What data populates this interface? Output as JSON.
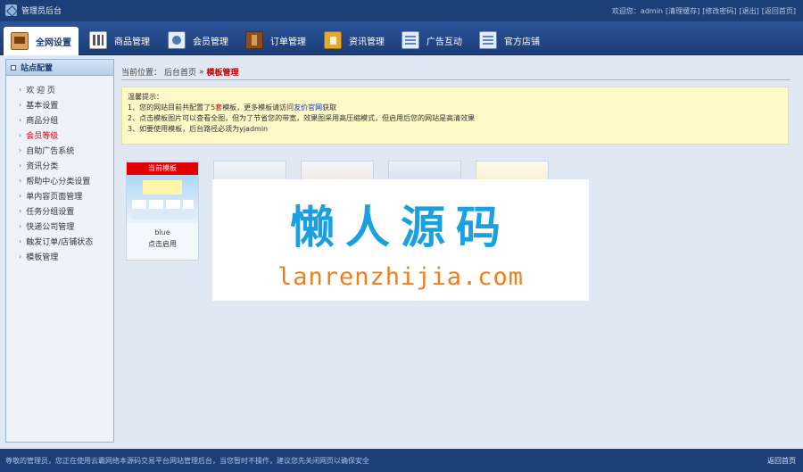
{
  "topbar": {
    "brand": "管理员后台",
    "links": [
      "欢迎您：admin",
      "[清理缓存]",
      "[修改密码]",
      "[退出]",
      "[返回首页]"
    ]
  },
  "nav": [
    {
      "label": "全网设置",
      "icon": "home-icon",
      "active": true
    },
    {
      "label": "商品管理",
      "icon": "goods-icon",
      "active": false
    },
    {
      "label": "会员管理",
      "icon": "member-icon",
      "active": false
    },
    {
      "label": "订单管理",
      "icon": "order-icon",
      "active": false
    },
    {
      "label": "资讯管理",
      "icon": "news-icon",
      "active": false
    },
    {
      "label": "广告互动",
      "icon": "ad-icon",
      "active": false
    },
    {
      "label": "官方店铺",
      "icon": "shop-icon",
      "active": false
    }
  ],
  "sidebar": {
    "title": "站点配置",
    "items": [
      {
        "label": "欢 迎 页"
      },
      {
        "label": "基本设置"
      },
      {
        "label": "商品分组"
      },
      {
        "label": "会员等级",
        "current": true
      },
      {
        "label": "自助广告系统"
      },
      {
        "label": "资讯分类"
      },
      {
        "label": "帮助中心分类设置"
      },
      {
        "label": "单内容页面管理"
      },
      {
        "label": "任务分组设置"
      },
      {
        "label": "快递公司管理"
      },
      {
        "label": "触发订单/店铺状态"
      },
      {
        "label": "模板管理"
      }
    ]
  },
  "breadcrumb": {
    "prefix": "当前位置：",
    "home": "后台首页",
    "sep": "»",
    "current": "模板管理"
  },
  "notice": {
    "title": "温馨提示：",
    "line1_a": "1、您的网站目前共配置了",
    "line1_hl": "5套",
    "line1_b": "模板，更多模板请访问",
    "line1_link": "友价官网",
    "line1_c": "获取",
    "line2": "2、点击模板图片可以查看全图，但为了节省您的带宽，效果图采用高压缩模式，但启用后您的网站是高清效果",
    "line3": "3、如要使用模板，后台路径必须为yjadmin"
  },
  "templates": {
    "current_tag": "当前模板",
    "first_name": "blue",
    "first_action": "点击启用"
  },
  "watermark": {
    "cn": "懒人源码",
    "en": "lanrenzhijia.com"
  },
  "footer": {
    "msg": "尊敬的管理员，您正在使用云霸网络本源码交易平台网站管理后台，当您暂时不操作，建议您先关闭网页以确保安全",
    "back": "返回首页"
  }
}
